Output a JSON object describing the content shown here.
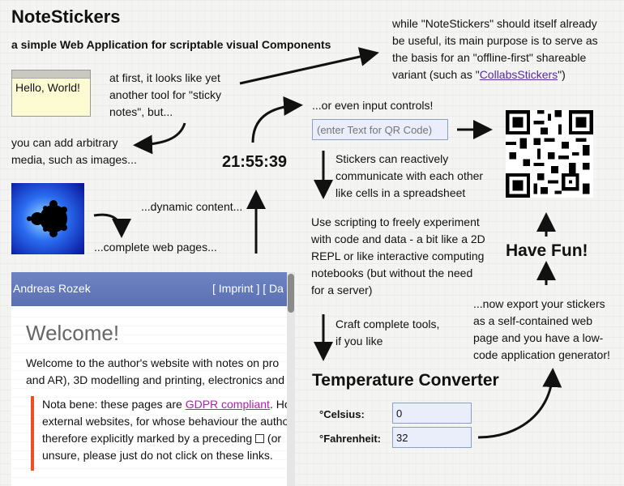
{
  "app": {
    "title": "NoteStickers",
    "subtitle": "a simple Web Application for scriptable visual Components"
  },
  "intro": {
    "line1_a": "while \"NoteStickers\" should itself already",
    "line1_b": "be useful, its main purpose is to serve as",
    "line1_c": "the basis for an \"offline-first\" shareable",
    "line1_d_prefix": "variant (such as \"",
    "link_text": "CollabsStickers",
    "line1_d_suffix": "\")"
  },
  "sticky": {
    "text": "Hello, World!"
  },
  "notes": {
    "first_look": [
      "at first, it looks like yet",
      "another tool for \"sticky",
      "notes\", but..."
    ],
    "media": [
      "you can add arbitrary",
      "media, such as images..."
    ],
    "dynamic": "...dynamic content...",
    "web_pages": "...complete web pages...",
    "input_controls": "...or even input controls!",
    "reactive": [
      "Stickers can reactively",
      "communicate with each other",
      "like cells in a spreadsheet"
    ],
    "scripting": [
      "Use scripting to freely experiment",
      "with code and data - a bit like a 2D",
      "REPL or like interactive computing",
      "notebooks (but without the need",
      "for a server)"
    ],
    "tools": [
      "Craft complete tools,",
      "if you like"
    ],
    "export": [
      "...now export your stickers",
      "as a self-contained web",
      "page and you have a low-",
      "code application generator!"
    ],
    "have_fun": "Have Fun!"
  },
  "clock": {
    "time": "21:55:39"
  },
  "qr_input": {
    "placeholder": "(enter Text for QR Code)"
  },
  "webpage": {
    "author": "Andreas Rozek",
    "imprint": "[ Imprint ]  [ Da",
    "welcome": "Welcome!",
    "intro_lines": [
      "Welcome to the author's website with notes on pro",
      "and AR), 3D modelling and printing, electronics and"
    ],
    "note_prefix": "Nota bene: these pages are ",
    "note_link": "GDPR compliant",
    "note_after_link": ". Ho",
    "note_lines": [
      "external websites, for whose behaviour the autho",
      "therefore explicitly marked by a preceding",
      "unsure, please just do not click on these links."
    ],
    "external_icon_suffix": " (or"
  },
  "converter": {
    "title": "Temperature Converter",
    "celsius_label": "°Celsius:",
    "celsius_value": "0",
    "fahrenheit_label": "°Fahrenheit:",
    "fahrenheit_value": "32"
  },
  "colors": {
    "header_blue": "#5f75b8",
    "note_border": "#f04f25",
    "link_purple": "#5a2aa0",
    "input_bg": "#e9eefa"
  }
}
